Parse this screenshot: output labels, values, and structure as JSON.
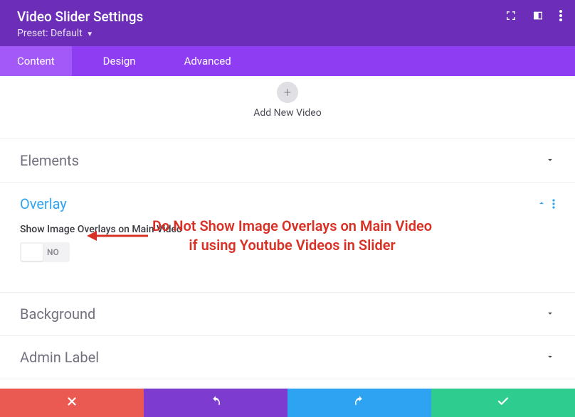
{
  "header": {
    "title": "Video Slider Settings",
    "preset_label": "Preset:",
    "preset_value": "Default"
  },
  "tabs": {
    "content": "Content",
    "design": "Design",
    "advanced": "Advanced"
  },
  "add_video": {
    "label": "Add New Video"
  },
  "sections": {
    "elements": "Elements",
    "overlay": "Overlay",
    "background": "Background",
    "admin_label": "Admin Label"
  },
  "overlay": {
    "field_label": "Show Image Overlays on Main Video",
    "toggle_value": "NO"
  },
  "annotation": {
    "line1": "Do Not Show Image Overlays on Main Video",
    "line2": "if using Youtube Videos in Slider"
  }
}
